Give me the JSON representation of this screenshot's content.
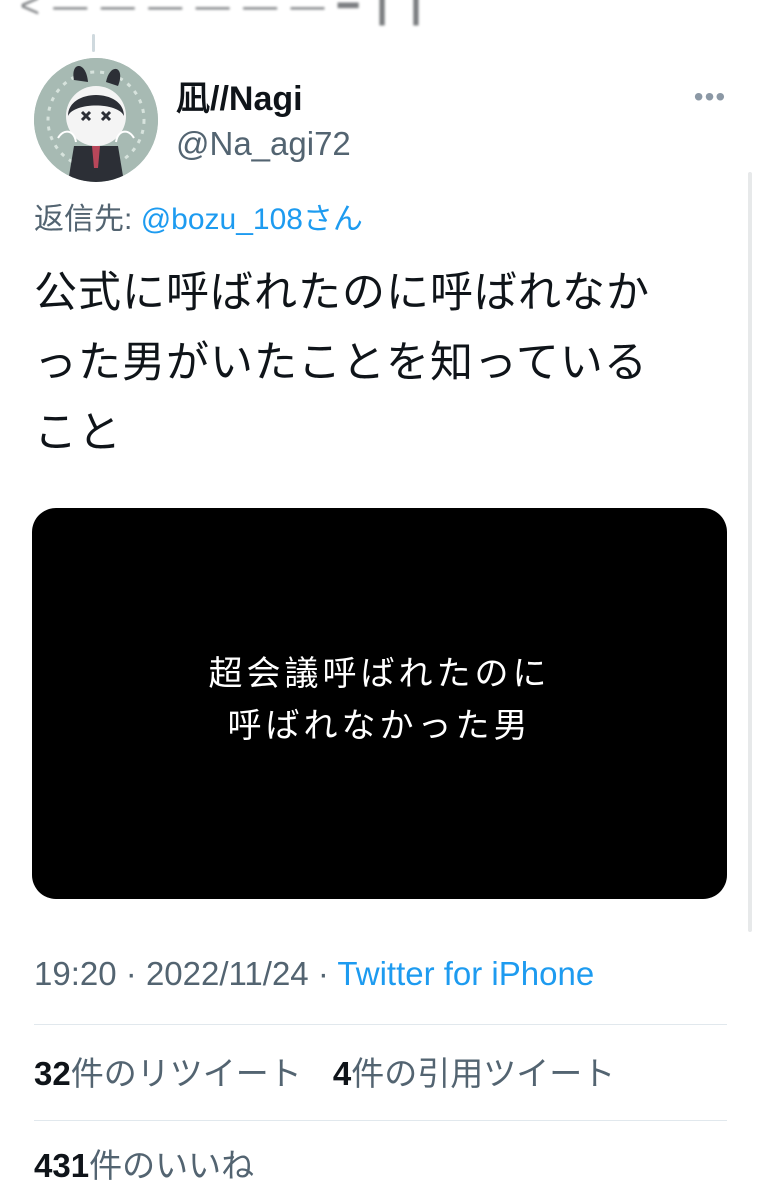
{
  "tweet": {
    "author_name": "凪//Nagi",
    "author_handle": "@Na_agi72",
    "reply_label": "返信先:",
    "reply_mention": "@bozu_108さん",
    "text_lines": [
      "公式に呼ばれたのに呼ばれなか",
      "った男がいたことを知っている",
      "こと"
    ],
    "media_caption_lines": [
      "超会議呼ばれたのに",
      "呼ばれなかった男"
    ],
    "time": "19:20",
    "date": "2022/11/24",
    "source": "Twitter for iPhone",
    "separator": "·",
    "more_icon": "more-horizontal-icon"
  },
  "stats": {
    "retweets_count": "32",
    "retweets_label": "件のリツイート",
    "quotes_count": "4",
    "quotes_label": "件の引用ツイート",
    "likes_count": "431",
    "likes_label": "件のいいね"
  },
  "colors": {
    "link": "#1d9bf0",
    "secondary_text": "#536471",
    "primary_text": "#0f1419",
    "media_background": "#000000"
  }
}
